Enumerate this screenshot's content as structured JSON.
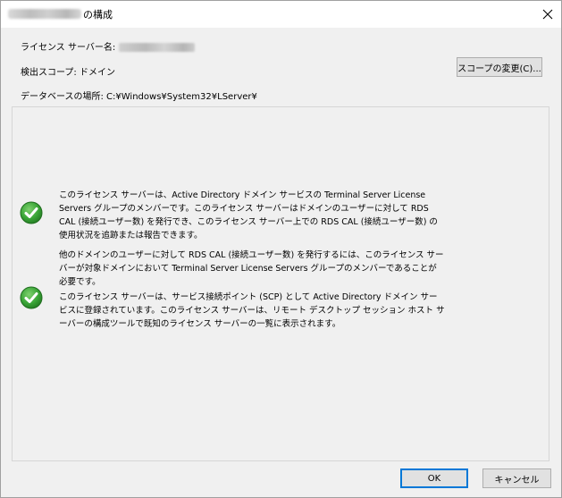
{
  "window": {
    "title_suffix": "の構成"
  },
  "info": {
    "server_name_label": "ライセンス サーバー名:",
    "scope_label": "検出スコープ: ドメイン",
    "db_label": "データベースの場所: C:¥Windows¥System32¥LServer¥"
  },
  "buttons": {
    "change_scope": "スコープの変更(C)...",
    "ok": "OK",
    "cancel": "キャンセル"
  },
  "messages": {
    "msg1": "このライセンス サーバーは、Active Directory ドメイン サービスの Terminal Server License Servers グループのメンバーです。このライセンス サーバーはドメインのユーザーに対して RDS CAL (接続ユーザー数) を発行でき、このライセンス サーバー上での RDS CAL (接続ユーザー数) の使用状況を追跡または報告できます。",
    "msg2": "他のドメインのユーザーに対して RDS CAL (接続ユーザー数) を発行するには、このライセンス サーバーが対象ドメインにおいて Terminal Server License Servers グループのメンバーであることが必要です。",
    "msg3": "このライセンス サーバーは、サービス接続ポイント (SCP) として Active Directory ドメイン サービスに登録されています。このライセンス サーバーは、リモート デスクトップ セッション ホスト サーバーの構成ツールで既知のライセンス サーバーの一覧に表示されます。"
  },
  "icons": {
    "status": "check-icon",
    "close": "close-icon"
  },
  "colors": {
    "check_green": "#3aa537",
    "ok_border": "#0078d7"
  }
}
